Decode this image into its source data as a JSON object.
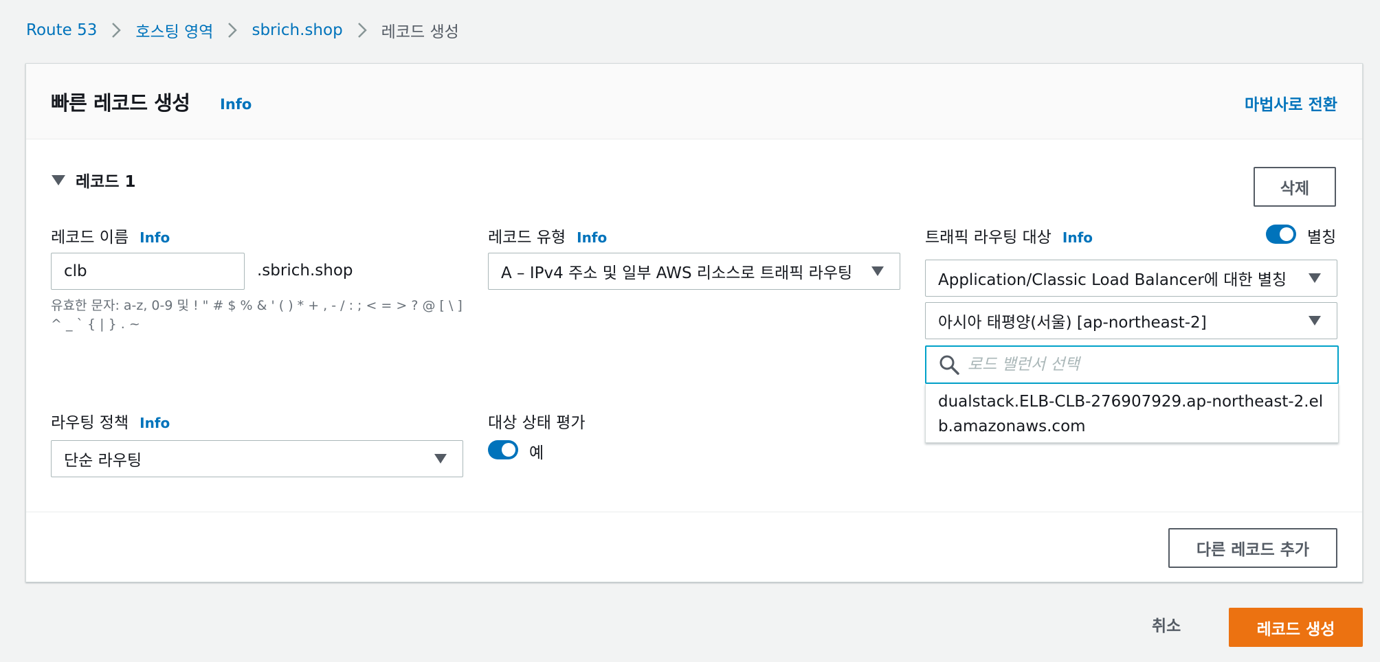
{
  "breadcrumb": {
    "items": [
      "Route 53",
      "호스팅 영역",
      "sbrich.shop"
    ],
    "current": "레코드 생성"
  },
  "card": {
    "title": "빠른 레코드 생성",
    "info": "Info",
    "switch_wizard": "마법사로 전환"
  },
  "record": {
    "section_title": "레코드 1",
    "delete_label": "삭제",
    "name": {
      "label": "레코드 이름",
      "info": "Info",
      "value": "clb",
      "suffix": ".sbrich.shop",
      "hint": "유효한 문자: a-z, 0-9 및 ! \" # $ % & ' ( ) * + , - / : ; < = > ? @ [ \\ ] ^ _ ` { | } . ~"
    },
    "type": {
      "label": "레코드 유형",
      "info": "Info",
      "value": "A – IPv4 주소 및 일부 AWS 리소스로 트래픽 라우팅"
    },
    "traffic": {
      "label": "트래픽 라우팅 대상",
      "info": "Info",
      "alias_label": "별칭",
      "alias_on": true,
      "endpoint_value": "Application/Classic Load Balancer에 대한 별칭",
      "region_value": "아시아 태평양(서울) [ap-northeast-2]",
      "search_placeholder": "로드 밸런서 선택",
      "options": [
        "dualstack.ELB-CLB-276907929.ap-northeast-2.elb.amazonaws.com"
      ]
    },
    "routing_policy": {
      "label": "라우팅 정책",
      "info": "Info",
      "value": "단순 라우팅"
    },
    "health": {
      "label": "대상 상태 평가",
      "toggle_label": "예",
      "on": true
    }
  },
  "add_record_label": "다른 레코드 추가",
  "footer": {
    "cancel": "취소",
    "create": "레코드 생성"
  },
  "colors": {
    "link": "#0073bb",
    "primary": "#ec7211",
    "focus": "#00a1c9"
  }
}
